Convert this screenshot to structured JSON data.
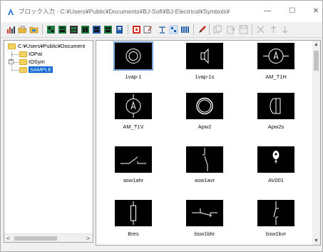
{
  "window": {
    "title": "ブロック入力 - C:¥Users¥Public¥Documents¥BJ-Soft¥BJ-Electrical¥Symbols¥",
    "minimize": "—",
    "maximize": "☐",
    "close": "✕"
  },
  "colors": {
    "accent": "#0a64d2",
    "folder": "#f4d262",
    "thumb_bg": "#000000",
    "symbol_stroke": "#ffffff"
  },
  "toolbar": {
    "icons": [
      "chart-icon",
      "folder-open-icon",
      "folder-icon",
      "grid-1-icon",
      "grid-2-icon",
      "grid-3-icon",
      "grid-4-icon",
      "grid-5-icon",
      "grid-6-icon",
      "book-icon",
      "symbol-red-icon",
      "symbol-edit-icon",
      "text-icon",
      "list-icon",
      "columns-icon",
      "pen-icon",
      "copy-icon",
      "paste-icon",
      "save-icon",
      "delete-icon",
      "move-up-icon",
      "move-down-icon"
    ]
  },
  "tree": {
    "root": "C:¥Users¥Public¥Document",
    "items": [
      {
        "label": "IOPat",
        "expandable": false
      },
      {
        "label": "IOSym",
        "expandable": true,
        "expander": "+"
      },
      {
        "label": "SAMPLE",
        "selected": true
      }
    ],
    "scroll_left": "<",
    "scroll_right": ">"
  },
  "symbols": [
    {
      "label": "1vap-1",
      "icon": "double-circle-icon",
      "selected": true
    },
    {
      "label": "1vap-1s",
      "icon": "speaker-icon"
    },
    {
      "label": "AM_T1H",
      "icon": "ammeter-icon"
    },
    {
      "label": "AM_T1V",
      "icon": "ammeter-icon"
    },
    {
      "label": "Apw2",
      "icon": "ring-icon"
    },
    {
      "label": "Apw2s",
      "icon": "cylinder-icon"
    },
    {
      "label": "asw1ahr",
      "icon": "switch-horizontal-icon"
    },
    {
      "label": "asw1avr",
      "icon": "switch-vertical-icon"
    },
    {
      "label": "AV001",
      "icon": "bulb-icon"
    },
    {
      "label": "Bres",
      "icon": "resistor-icon"
    },
    {
      "label": "bsw1bhr",
      "icon": "switch-b-horizontal-icon"
    },
    {
      "label": "bsw1bvr",
      "icon": "switch-b-vertical-icon"
    }
  ],
  "scrollbar": {
    "up": "▲",
    "down": "▼"
  }
}
